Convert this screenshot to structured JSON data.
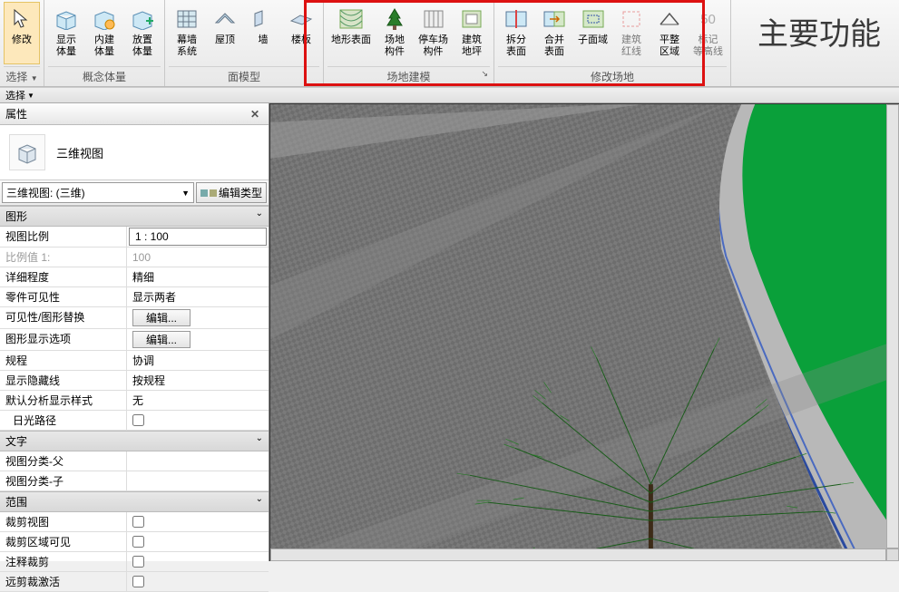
{
  "ribbon": {
    "group_select": {
      "label": "选择",
      "btn_modify": "修改"
    },
    "group_mass": {
      "label": "概念体量",
      "btn_showmass": "显示\n体量",
      "btn_inplacemass": "内建\n体量",
      "btn_placemass": "放置\n体量"
    },
    "group_face": {
      "label": "面模型",
      "btn_curtain": "幕墙\n系统",
      "btn_roof": "屋顶",
      "btn_wall": "墙",
      "btn_floor": "楼板"
    },
    "group_sitemodel": {
      "label": "场地建模",
      "btn_topo": "地形表面",
      "btn_sitecomp": "场地\n构件",
      "btn_parking": "停车场\n构件",
      "btn_pad": "建筑\n地坪"
    },
    "group_editsite": {
      "label": "修改场地",
      "btn_split": "拆分\n表面",
      "btn_merge": "合并\n表面",
      "btn_subregion": "子面域",
      "btn_propline": "建筑\n红线",
      "btn_graded": "平整\n区域",
      "btn_label": "标记\n等高线",
      "btn_label_num": "50"
    },
    "annotation": "主要功能",
    "select_bar": "选择"
  },
  "props": {
    "title": "属性",
    "type": {
      "name": "三维视图"
    },
    "instance_dd": "三维视图: (三维)",
    "edit_type": "编辑类型",
    "sec_graphics": "图形",
    "rows": {
      "view_scale": {
        "label": "视图比例",
        "value": "1 : 100"
      },
      "scale_value": {
        "label": "比例值 1:",
        "value": "100"
      },
      "detail": {
        "label": "详细程度",
        "value": "精细"
      },
      "parts_vis": {
        "label": "零件可见性",
        "value": "显示两者"
      },
      "vis_override": {
        "label": "可见性/图形替换",
        "value": "编辑..."
      },
      "graphic_disp": {
        "label": "图形显示选项",
        "value": "编辑..."
      },
      "discipline": {
        "label": "规程",
        "value": "协调"
      },
      "hidden": {
        "label": "显示隐藏线",
        "value": "按规程"
      },
      "analysis": {
        "label": "默认分析显示样式",
        "value": "无"
      },
      "sunpath": {
        "label": "日光路径"
      }
    },
    "sec_text": "文字",
    "rows_text": {
      "view_cat_parent": {
        "label": "视图分类-父"
      },
      "view_cat_child": {
        "label": "视图分类-子"
      }
    },
    "sec_extents": "范围",
    "rows_ext": {
      "crop_view": {
        "label": "裁剪视图"
      },
      "crop_vis": {
        "label": "裁剪区域可见"
      },
      "anno_crop": {
        "label": "注释裁剪"
      },
      "far_clip": {
        "label": "远剪裁激活"
      }
    }
  }
}
